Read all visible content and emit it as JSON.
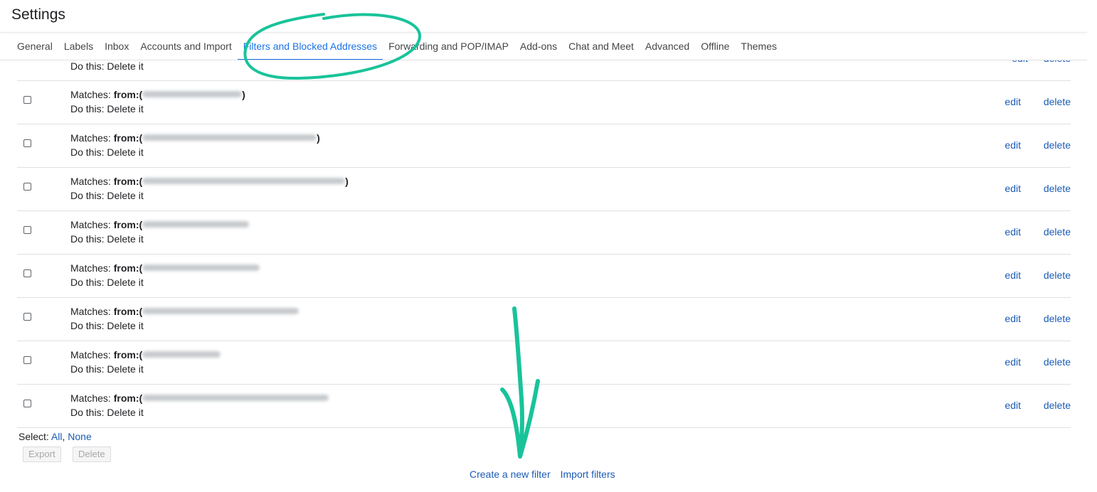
{
  "header": {
    "title": "Settings"
  },
  "tabs": [
    {
      "label": "General"
    },
    {
      "label": "Labels"
    },
    {
      "label": "Inbox"
    },
    {
      "label": "Accounts and Import"
    },
    {
      "label": "Filters and Blocked Addresses",
      "active": true
    },
    {
      "label": "Forwarding and POP/IMAP"
    },
    {
      "label": "Add-ons"
    },
    {
      "label": "Chat and Meet"
    },
    {
      "label": "Advanced"
    },
    {
      "label": "Offline"
    },
    {
      "label": "Themes"
    }
  ],
  "partial_row": {
    "action": "Do this: Delete it",
    "edit": "edit",
    "delete": "delete"
  },
  "filters": [
    {
      "matches_prefix": "Matches: ",
      "from_label": "from:(",
      "close": ")",
      "action": "Do this: Delete it",
      "edit": "edit",
      "delete": "delete"
    },
    {
      "matches_prefix": "Matches: ",
      "from_label": "from:(",
      "close": ")",
      "action": "Do this: Delete it",
      "edit": "edit",
      "delete": "delete"
    },
    {
      "matches_prefix": "Matches: ",
      "from_label": "from:(",
      "close": ")",
      "action": "Do this: Delete it",
      "edit": "edit",
      "delete": "delete"
    },
    {
      "matches_prefix": "Matches: ",
      "from_label": "from:(",
      "close": "",
      "action": "Do this: Delete it",
      "edit": "edit",
      "delete": "delete"
    },
    {
      "matches_prefix": "Matches: ",
      "from_label": "from:(",
      "close": "",
      "action": "Do this: Delete it",
      "edit": "edit",
      "delete": "delete"
    },
    {
      "matches_prefix": "Matches: ",
      "from_label": "from:(",
      "close": "",
      "action": "Do this: Delete it",
      "edit": "edit",
      "delete": "delete"
    },
    {
      "matches_prefix": "Matches: ",
      "from_label": "from:(",
      "close": "",
      "action": "Do this: Delete it",
      "edit": "edit",
      "delete": "delete"
    },
    {
      "matches_prefix": "Matches: ",
      "from_label": "from:(",
      "close": "",
      "action": "Do this: Delete it",
      "edit": "edit",
      "delete": "delete"
    }
  ],
  "select": {
    "label": "Select: ",
    "all": "All",
    "sep": ", ",
    "none": "None"
  },
  "buttons": {
    "export": "Export",
    "delete": "Delete"
  },
  "footer": {
    "create": "Create a new filter",
    "import": "Import filters"
  },
  "colors": {
    "accent": "#1a73e8",
    "link": "#1a5bb5",
    "annotation": "#19c39a"
  }
}
